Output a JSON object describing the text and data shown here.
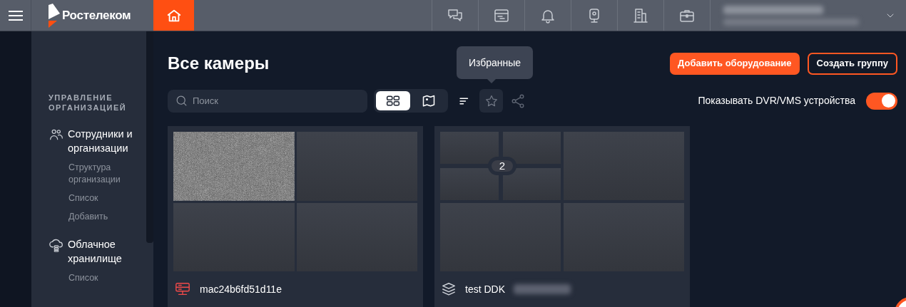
{
  "header": {
    "logo": "Ростелеком",
    "home_selected": true
  },
  "sidebar": {
    "section_title": "УПРАВЛЕНИЕ ОРГАНИЗАЦИЕЙ",
    "groups": [
      {
        "kind": "people",
        "title": "Сотрудники и организации",
        "items": [
          "Структура организации",
          "Список",
          "Добавить"
        ]
      },
      {
        "kind": "cloud",
        "title": "Облачное хранилище",
        "items": [
          "Список"
        ]
      }
    ]
  },
  "page": {
    "title": "Все камеры",
    "buttons": [
      {
        "label": "Добавить оборудование",
        "kind": "primary"
      },
      {
        "label": "Создать группу",
        "kind": "outline"
      }
    ]
  },
  "toolbar": {
    "search": {
      "placeholder": "Поиск"
    },
    "views": [
      {
        "kind": "grid",
        "selected": true
      },
      {
        "kind": "map",
        "selected": false
      }
    ],
    "tooltip": "Избранные",
    "dvr_toggle": {
      "label": "Показывать DVR/VMS устройства",
      "on": true
    }
  },
  "cards": [
    {
      "kind": "device",
      "name": "mac24b6fd51d11e"
    },
    {
      "kind": "group",
      "name": "test DDK",
      "count": "2"
    }
  ]
}
